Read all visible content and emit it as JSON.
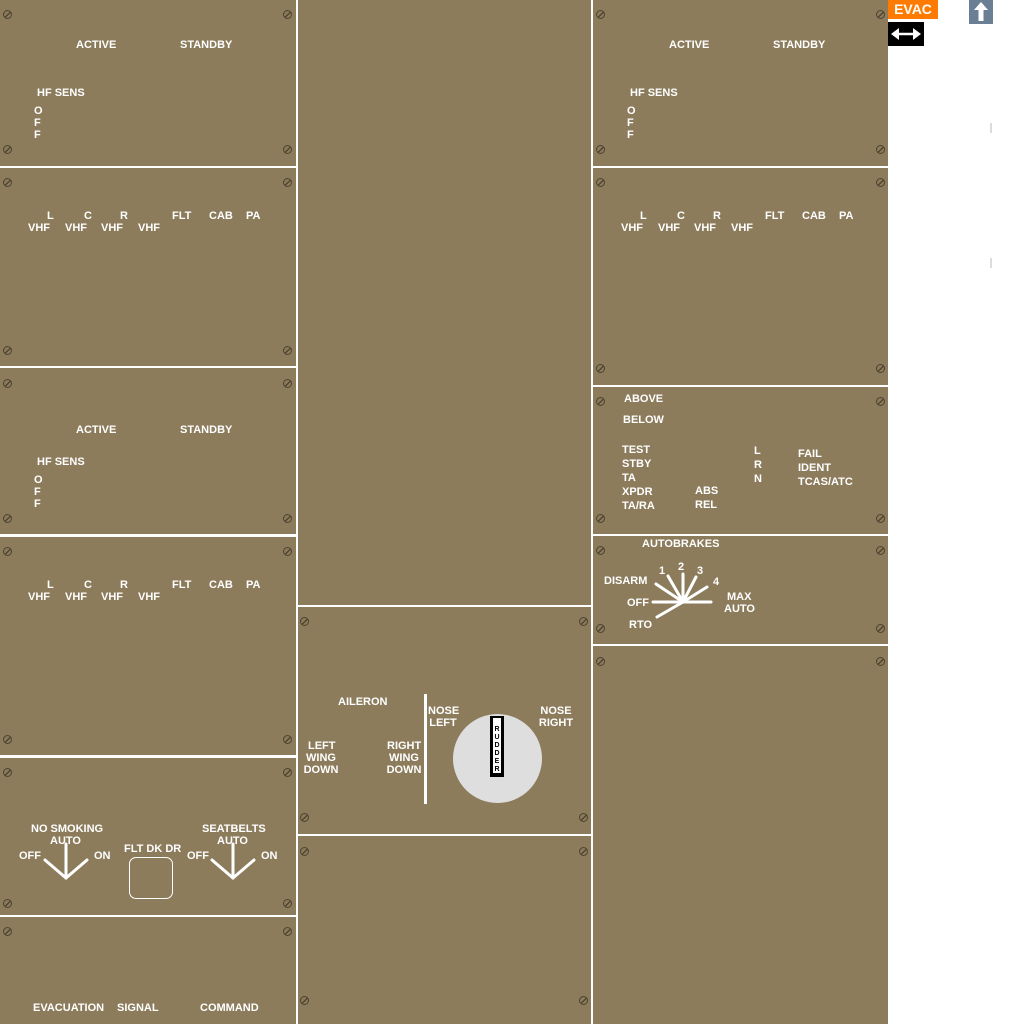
{
  "colors": {
    "panel": "#8c7c5c",
    "panel_border": "#6e6148",
    "label": "#ffffff",
    "evac_orange": "#ff7a00",
    "knob": "#dedede"
  },
  "side": {
    "evac_label": "EVAC",
    "swap_icon": "left-right-arrow",
    "up_icon": "up-arrow"
  },
  "radio_tuning": {
    "active": "ACTIVE",
    "standby": "STANDBY",
    "hf_sens": "HF SENS",
    "off_chars": [
      "O",
      "F",
      "F"
    ]
  },
  "audio_control": {
    "l": "L",
    "c": "C",
    "r": "R",
    "vhf": "VHF",
    "flt": "FLT",
    "cab": "CAB",
    "pa": "PA"
  },
  "transponder": {
    "above": "ABOVE",
    "below": "BELOW",
    "modes": [
      "TEST",
      "STBY",
      "TA",
      "XPDR",
      "TA/RA"
    ],
    "abs": "ABS",
    "rel": "REL",
    "side_chars": [
      "L",
      "R",
      "N"
    ],
    "fail": "FAIL",
    "ident": "IDENT",
    "tcas_atc": "TCAS/ATC"
  },
  "autobrakes": {
    "title": "AUTOBRAKES",
    "disarm": "DISARM",
    "off": "OFF",
    "rto": "RTO",
    "settings": [
      "1",
      "2",
      "3",
      "4"
    ],
    "max": "MAX",
    "auto": "AUTO"
  },
  "trim": {
    "aileron": "AILERON",
    "left_wing_down": [
      "LEFT",
      "WING",
      "DOWN"
    ],
    "right_wing_down": [
      "RIGHT",
      "WING",
      "DOWN"
    ],
    "nose_left": [
      "NOSE",
      "LEFT"
    ],
    "nose_right": [
      "NOSE",
      "RIGHT"
    ],
    "rudder_chars": [
      "R",
      "U",
      "D",
      "D",
      "E",
      "R"
    ]
  },
  "signs": {
    "no_smoking": "NO SMOKING",
    "seatbelts": "SEATBELTS",
    "auto": "AUTO",
    "off": "OFF",
    "on": "ON",
    "flt_dk_dr": "FLT DK DR"
  },
  "evacuation": {
    "evacuation": "EVACUATION",
    "signal": "SIGNAL",
    "command": "COMMAND"
  }
}
